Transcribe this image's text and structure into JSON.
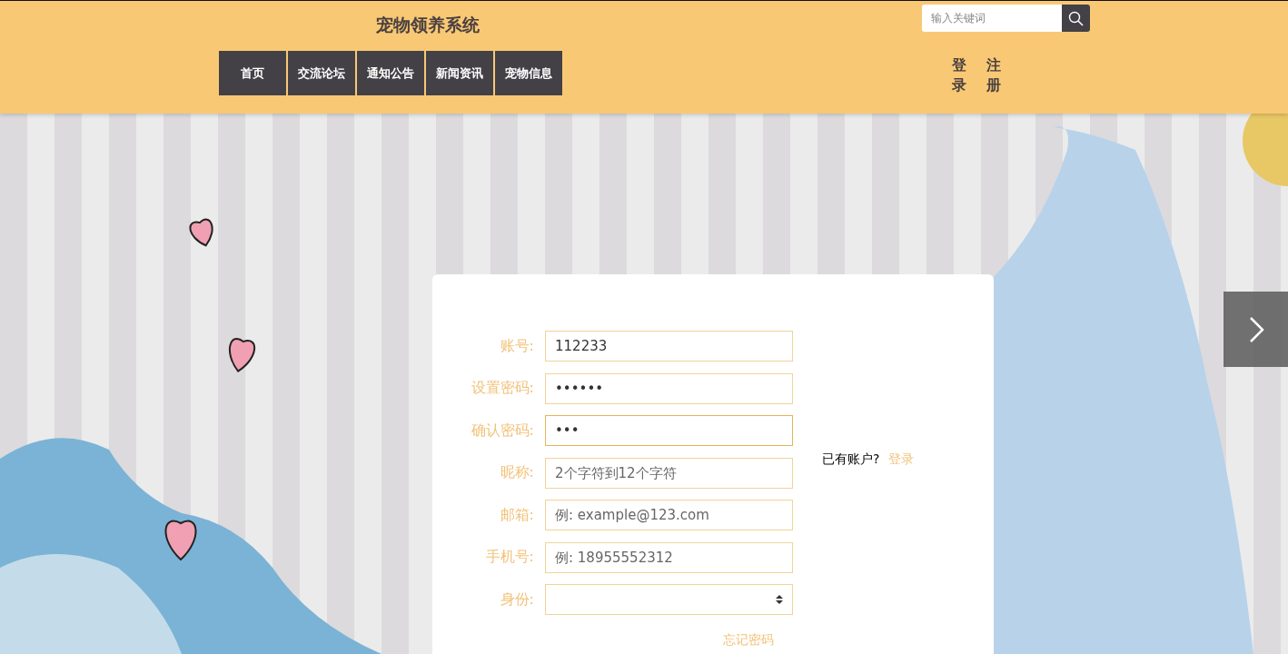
{
  "header": {
    "title": "宠物领养系统",
    "nav": [
      {
        "label": "首页"
      },
      {
        "label": "交流论坛"
      },
      {
        "label": "通知公告"
      },
      {
        "label": "新闻资讯"
      },
      {
        "label": "宠物信息"
      }
    ],
    "search": {
      "placeholder": "输入关键词"
    },
    "auth_links": [
      "登录",
      "注册"
    ]
  },
  "form": {
    "fields": [
      {
        "label": "账号:",
        "kind": "text",
        "value": "112233"
      },
      {
        "label": "设置密码:",
        "kind": "password",
        "value": "••••••"
      },
      {
        "label": "确认密码:",
        "kind": "password",
        "value": "•••",
        "focused": true
      },
      {
        "label": "昵称:",
        "kind": "text",
        "placeholder": "2个字符到12个字符"
      },
      {
        "label": "邮箱:",
        "kind": "text",
        "placeholder": "例: example@123.com"
      },
      {
        "label": "手机号:",
        "kind": "text",
        "placeholder": "例: 18955552312"
      },
      {
        "label": "身份:",
        "kind": "select"
      }
    ],
    "forgot_link": "忘记密码",
    "aside": {
      "text": "已有账户?",
      "link": "登录"
    }
  }
}
